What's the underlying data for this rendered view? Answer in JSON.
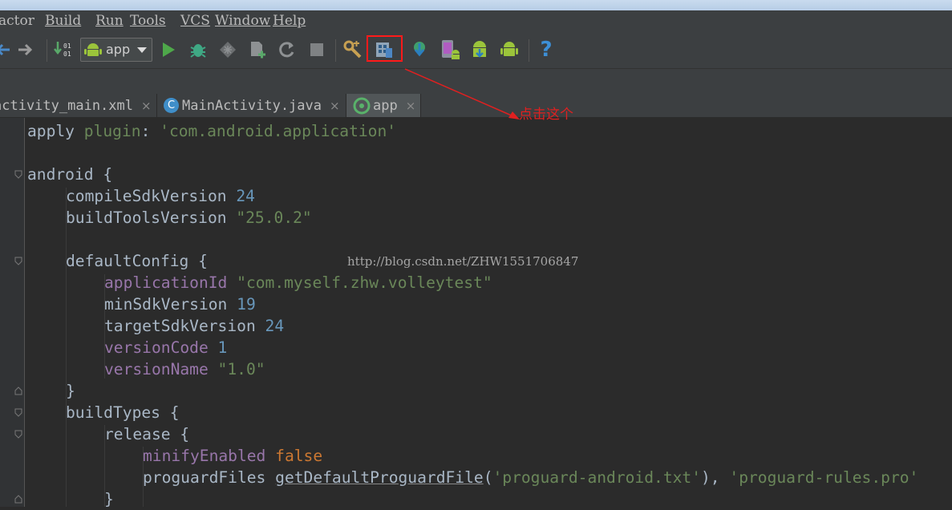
{
  "menu": {
    "refactor": "actor",
    "build": "Build",
    "run": "Run",
    "tools": "Tools",
    "vcs": "VCS",
    "window": "Window",
    "help": "Help"
  },
  "toolbar": {
    "run_config": "app",
    "help_glyph": "?"
  },
  "tabs": [
    {
      "label": "activity_main.xml",
      "close": "×"
    },
    {
      "label": "MainActivity.java",
      "close": "×",
      "icon_letter": "C"
    },
    {
      "label": "app",
      "close": "×"
    }
  ],
  "annotation": {
    "callout": "点击这个",
    "watermark": "http://blog.csdn.net/ZHW1551706847"
  },
  "code": {
    "l1_a": "apply ",
    "l1_b": "plugin",
    "l1_c": ": ",
    "l1_d": "'com.android.application'",
    "l3": "android {",
    "l4_a": "compileSdkVersion ",
    "l4_b": "24",
    "l5_a": "buildToolsVersion ",
    "l5_b": "\"25.0.2\"",
    "l7": "defaultConfig {",
    "l8_a": "applicationId",
    "l8_b": " \"com.myself.zhw.volleytest\"",
    "l9_a": "minSdkVersion ",
    "l9_b": "19",
    "l10_a": "targetSdkVersion ",
    "l10_b": "24",
    "l11_a": "versionCode",
    "l11_b": " 1",
    "l12_a": "versionName",
    "l12_b": " \"1.0\"",
    "l13": "}",
    "l14": "buildTypes {",
    "l15": "release {",
    "l16_a": "minifyEnabled",
    "l16_b": " false",
    "l17_a": "proguardFiles ",
    "l17_b": "getDefaultProguardFile",
    "l17_c": "(",
    "l17_d": "'proguard-android.txt'",
    "l17_e": "), ",
    "l17_f": "'proguard-rules.pro'",
    "l18": "}"
  },
  "colors": {
    "editor_bg": "#2b2b2b",
    "string": "#6a8759",
    "number": "#6897bb",
    "property": "#9876aa",
    "keyword": "#cc7832",
    "highlight_box": "#ff1a1a"
  }
}
